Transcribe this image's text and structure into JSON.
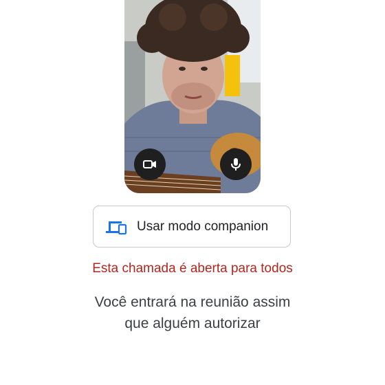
{
  "preview": {
    "camera_icon": "videocam-icon",
    "mic_icon": "mic-icon"
  },
  "companion_button": {
    "icon": "devices-icon",
    "label": "Usar modo companion",
    "accent": "#1a73e8"
  },
  "notice": {
    "open_call": "Esta chamada é aberta para todos",
    "open_call_color": "#b3261e",
    "waiting_line1": "Você entrará na reunião assim",
    "waiting_line2": "que alguém autorizar"
  }
}
